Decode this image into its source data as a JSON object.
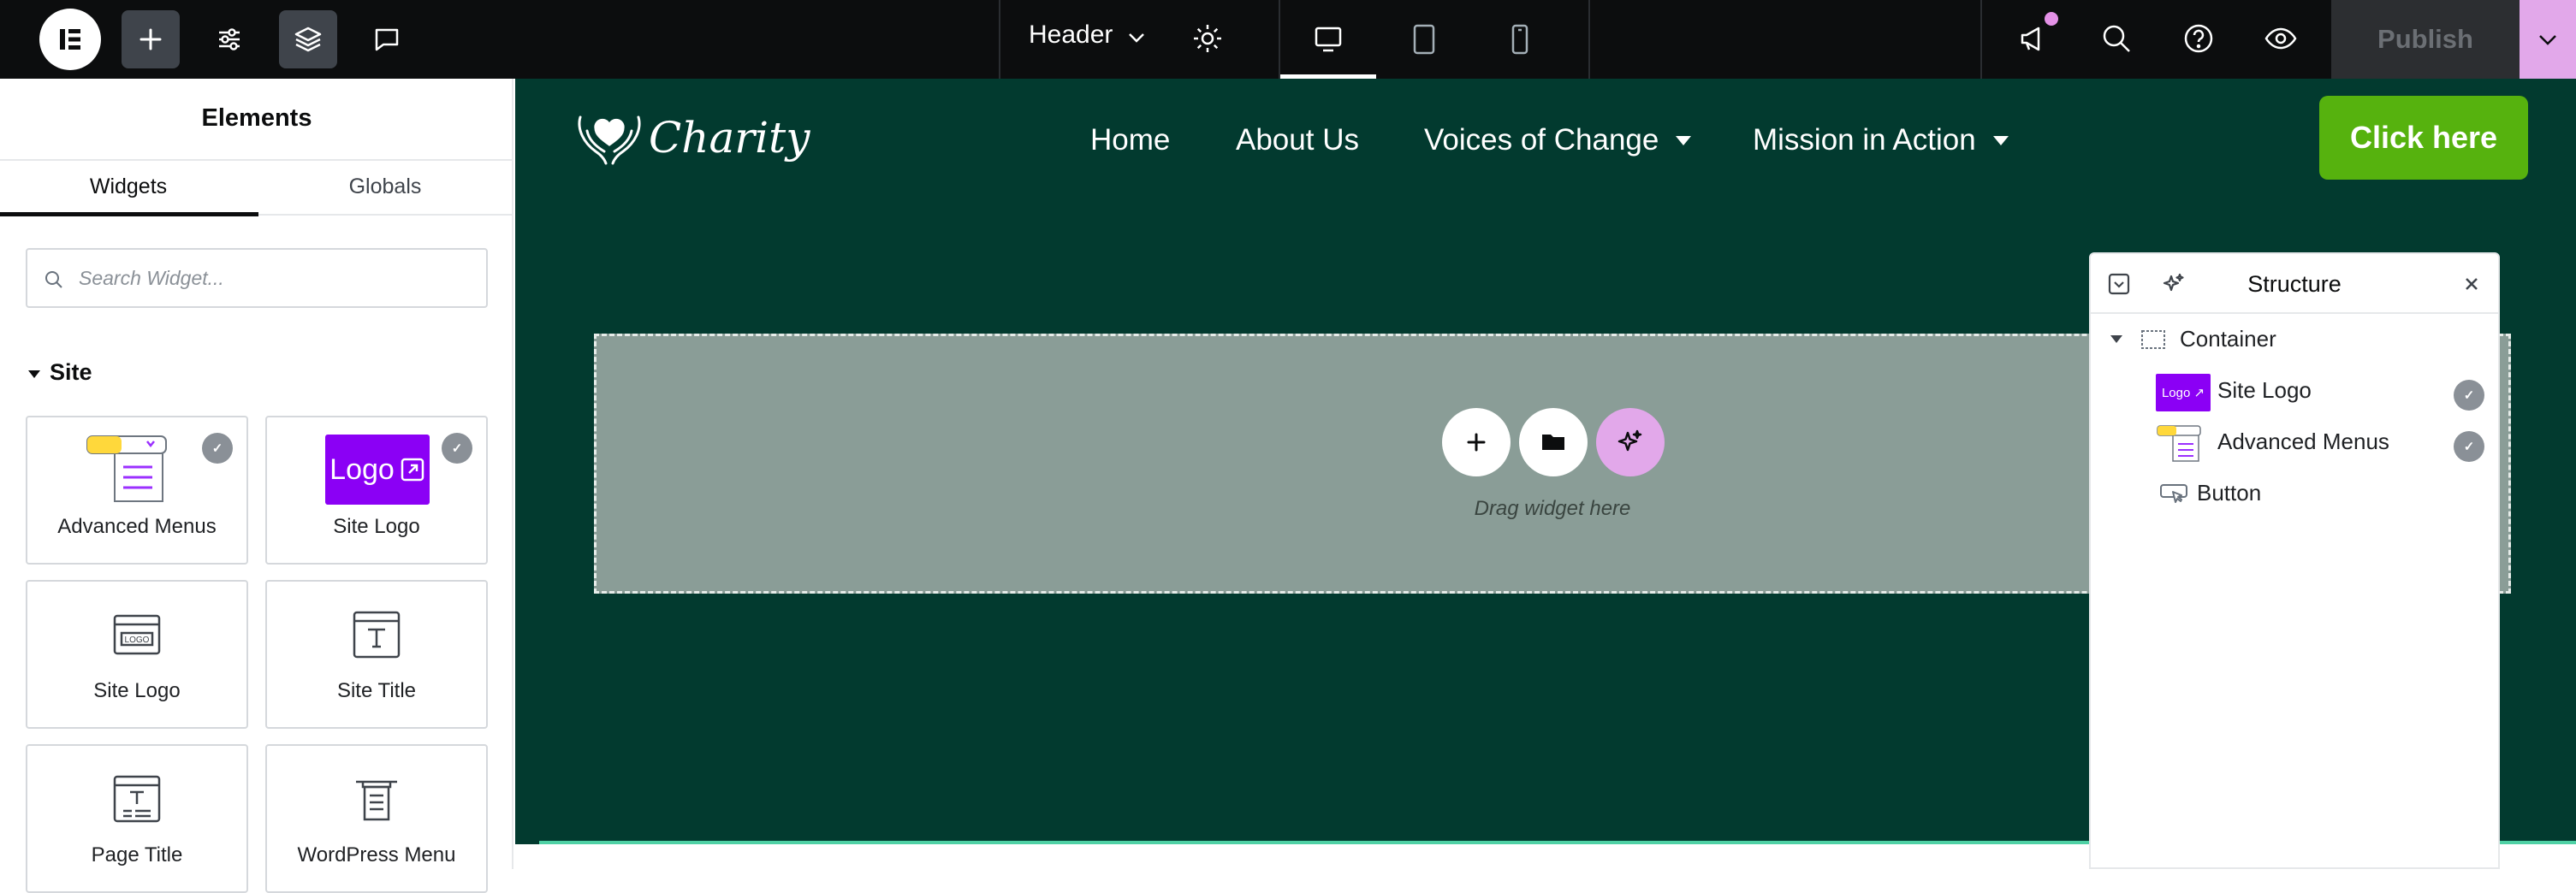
{
  "topbar": {
    "document_title": "Header",
    "publish_label": "Publish"
  },
  "panel": {
    "title": "Elements",
    "tabs": [
      {
        "label": "Widgets",
        "active": true
      },
      {
        "label": "Globals",
        "active": false
      }
    ],
    "search_placeholder": "Search Widget...",
    "category": "Site",
    "widgets": [
      {
        "label": "Advanced Menus",
        "pro": true
      },
      {
        "label": "Site Logo",
        "pro": true
      },
      {
        "label": "Site Logo",
        "pro": false
      },
      {
        "label": "Site Title",
        "pro": false
      },
      {
        "label": "Page Title",
        "pro": false
      },
      {
        "label": "WordPress Menu",
        "pro": false
      }
    ],
    "logo_tile_text": "Logo"
  },
  "site": {
    "logo_text": "Charity",
    "nav": [
      {
        "label": "Home",
        "has_dropdown": false
      },
      {
        "label": "About Us",
        "has_dropdown": false
      },
      {
        "label": "Voices of Change",
        "has_dropdown": true
      },
      {
        "label": "Mission in Action",
        "has_dropdown": true
      }
    ],
    "cta_label": "Click here",
    "dropzone_hint": "Drag widget here"
  },
  "structure": {
    "title": "Structure",
    "items": [
      {
        "label": "Container",
        "level": 0
      },
      {
        "label": "Site Logo",
        "level": 1
      },
      {
        "label": "Advanced Menus",
        "level": 1
      },
      {
        "label": "Button",
        "level": 1
      }
    ]
  },
  "colors": {
    "header_bg": "#023a2f",
    "cta_bg": "#56b20e",
    "accent_pink": "#e2a8ea",
    "logo_purple": "#8b00f5"
  }
}
